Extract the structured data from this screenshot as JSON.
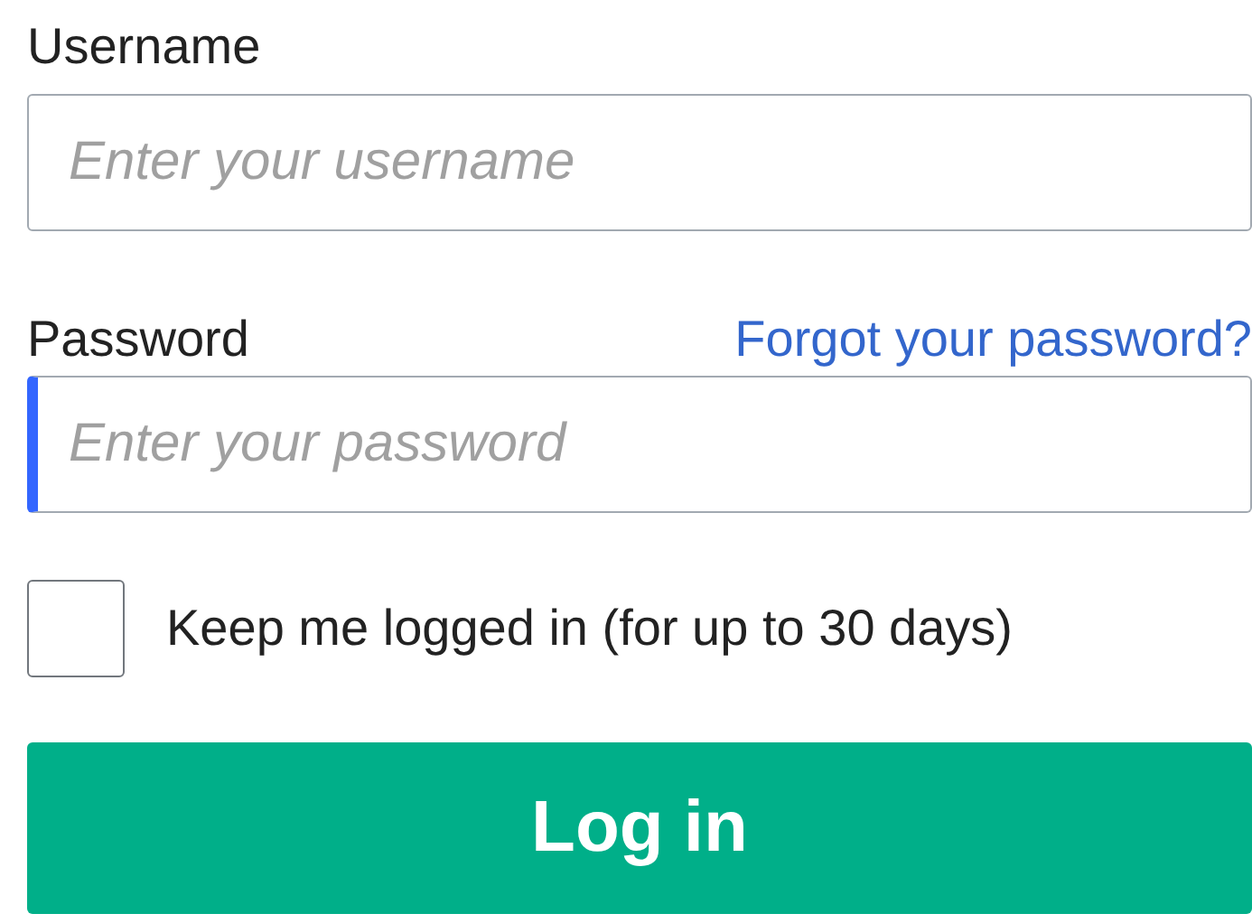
{
  "username": {
    "label": "Username",
    "placeholder": "Enter your username",
    "focused": false
  },
  "password": {
    "label": "Password",
    "placeholder": "Enter your password",
    "focused": true,
    "forgot_link": "Forgot your password?"
  },
  "remember": {
    "label": "Keep me logged in (for up to 30 days)",
    "checked": false
  },
  "submit": {
    "label": "Log in"
  }
}
